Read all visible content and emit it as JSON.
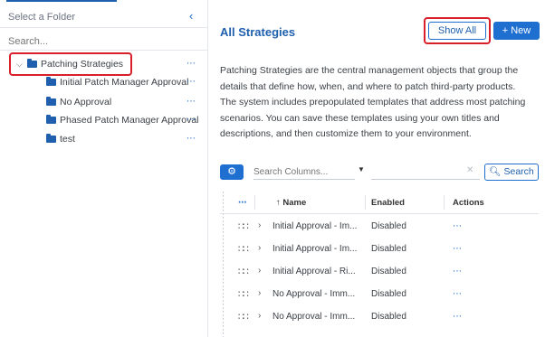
{
  "left_panel": {
    "folder_select_label": "Select a Folder",
    "search_placeholder": "Search...",
    "tree": [
      {
        "label": "Patching Strategies",
        "expanded": true,
        "level": 0
      },
      {
        "label": "Initial Patch Manager Approval",
        "level": 1
      },
      {
        "label": "No Approval",
        "level": 1
      },
      {
        "label": "Phased Patch Manager Approval",
        "level": 1
      },
      {
        "label": "test",
        "level": 1
      }
    ],
    "more_glyph": "⋯"
  },
  "main": {
    "title": "All Strategies",
    "show_all_label": "Show All",
    "new_label": "+ New",
    "description": "Patching Strategies are the central management objects that group the details that define how, when, and where to patch third-party products. The system includes prepopulated templates that address most patching scenarios. You can save these templates using your own titles and descriptions, and then customize them to your environment.",
    "toolbar": {
      "search_columns_placeholder": "Search Columns...",
      "search_button_label": "Search"
    },
    "table": {
      "columns": [
        "↑ Name",
        "Enabled",
        "Actions"
      ],
      "rows": [
        {
          "name": "Initial Approval - Im...",
          "enabled": "Disabled"
        },
        {
          "name": "Initial Approval - Im...",
          "enabled": "Disabled"
        },
        {
          "name": "Initial Approval - Ri...",
          "enabled": "Disabled"
        },
        {
          "name": "No Approval - Imm...",
          "enabled": "Disabled"
        },
        {
          "name": "No Approval - Imm...",
          "enabled": "Disabled"
        }
      ]
    }
  },
  "colors": {
    "accent": "#1f6fd1",
    "highlight_border": "#d9202a",
    "folder_icon": "#1f5fae"
  }
}
